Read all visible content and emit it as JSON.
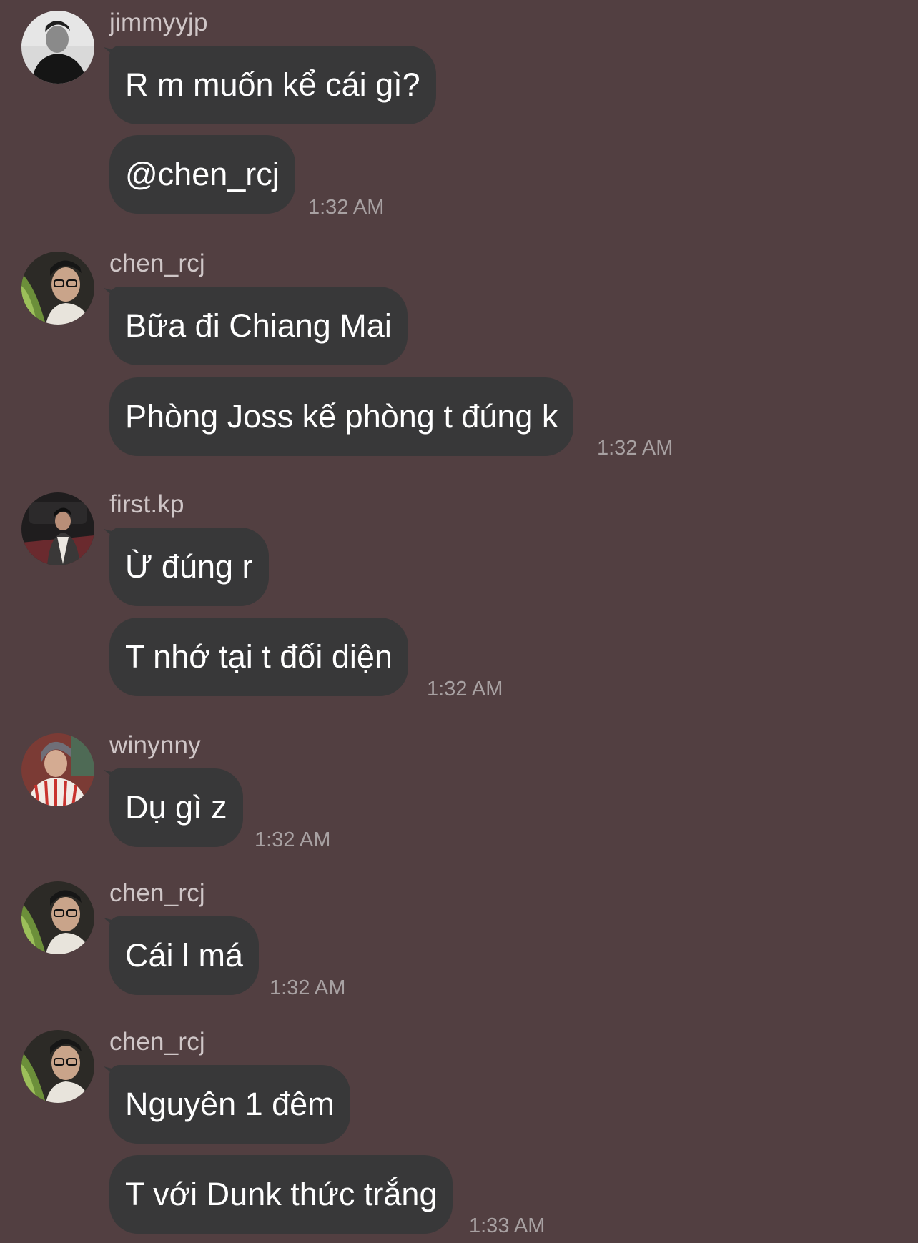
{
  "colors": {
    "background": "#523f41",
    "bubble": "#383839",
    "message_text": "#ffffff",
    "username_text": "#cfc6c7",
    "timestamp_text": "#a8a1a2"
  },
  "groups": [
    {
      "sender": "jimmyyjp",
      "avatar": "avatar-jimmyyjp",
      "messages": [
        "R m muốn kể cái gì?",
        "@chen_rcj"
      ],
      "time": "1:32 AM"
    },
    {
      "sender": "chen_rcj",
      "avatar": "avatar-chen_rcj",
      "messages": [
        "Bữa đi Chiang Mai",
        "Phòng Joss kế phòng t đúng k"
      ],
      "time": "1:32 AM"
    },
    {
      "sender": "first.kp",
      "avatar": "avatar-first.kp",
      "messages": [
        "Ừ đúng r",
        "T nhớ tại t đối diện"
      ],
      "time": "1:32 AM"
    },
    {
      "sender": "winynny",
      "avatar": "avatar-winynny",
      "messages": [
        "Dụ gì z"
      ],
      "time": "1:32 AM"
    },
    {
      "sender": "chen_rcj",
      "avatar": "avatar-chen_rcj",
      "messages": [
        "Cái l má"
      ],
      "time": "1:32 AM"
    },
    {
      "sender": "chen_rcj",
      "avatar": "avatar-chen_rcj",
      "messages": [
        "Nguyên 1 đêm",
        "T với Dunk thức trắng"
      ],
      "time": "1:33 AM"
    }
  ]
}
